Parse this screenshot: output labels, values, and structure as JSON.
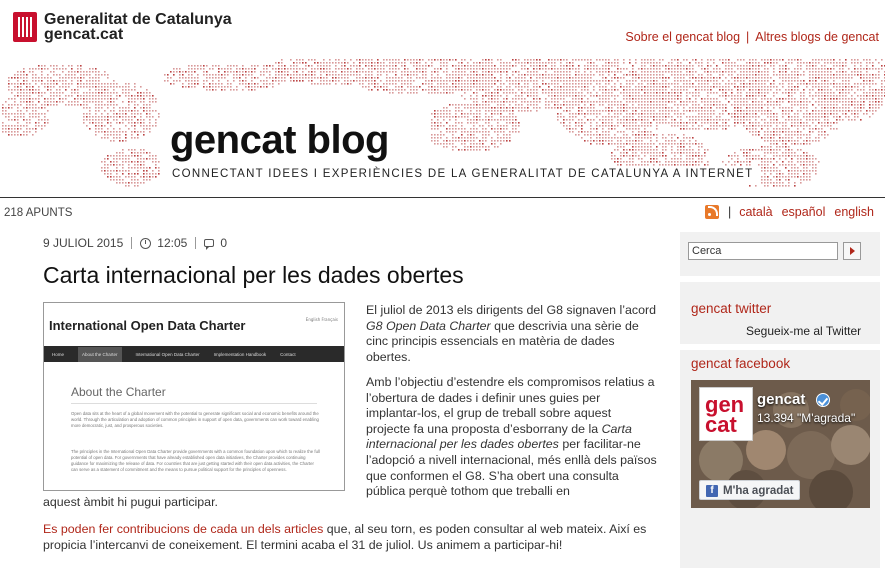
{
  "header": {
    "org_name": "Generalitat de Catalunya",
    "org_domain": "gencat.cat",
    "links": [
      "Sobre el gencat blog",
      "Altres blogs de gencat"
    ],
    "separator": "|"
  },
  "banner": {
    "title": "gencat blog",
    "tagline": "CONNECTANT IDEES I EXPERIÈNCIES DE LA GENERALITAT DE CATALUNYA A INTERNET"
  },
  "subbar": {
    "post_count": "218 APUNTS",
    "rss_icon": "rss-icon",
    "separator": "|",
    "languages": [
      "català",
      "español",
      "english"
    ]
  },
  "post": {
    "date": "9 JULIOL 2015",
    "time": "12:05",
    "comments": "0",
    "title": "Carta internacional per les dades obertes",
    "image": {
      "title": "International Open Data Charter",
      "langs": "English  Français",
      "nav": [
        "Home",
        "About the Charter",
        "International Open Data Charter",
        "Implementation Handbook",
        "Contact"
      ],
      "heading": "About the Charter",
      "p1": "Open data sits at the heart of a global movement with the potential to generate significant social and economic benefits around the world. Through the articulation and adoption of common principles in support of open data, governments can work toward enabling more democratic, just, and prosperous societies.",
      "p2": "The principles in the International Open Data Charter provide governments with a common foundation upon which to realize the full potential of open data. For governments that have already established open data initiatives, the Charter provides continuing guidance for maximizing the release of data. For countries that are just getting started with their open data activities, the Charter can serve as a statement of commitment and the means to pursue political support for the principles of openness."
    },
    "para1_a": "El juliol de 2013 els dirigents del G8 signaven l’acord ",
    "para1_em": "G8 Open Data Charter",
    "para1_b": " que descrivia una sèrie de cinc principis essencials en matèria de dades obertes.",
    "para2_a": "Amb l’objectiu d’estendre els compromisos relatius a l’obertura de dades i definir unes guies per implantar-los, el grup de treball sobre aquest projecte fa una proposta d’esborrany de la ",
    "para2_em": "Carta internacional per les dades obertes",
    "para2_b": " per facilitar-ne l’adopció a nivell internacional, més enllà dels països que conformen el G8. S’ha obert una consulta pública perquè tothom que treballi en",
    "para2_c": "aquest àmbit hi pugui participar.",
    "para3_link": "Es poden fer contribucions de cada un dels articles",
    "para3_rest": " que, al seu torn, es poden consultar al web mateix. Així es propicia l’intercanvi de coneixement. El termini acaba el 31 de juliol. Us animem a participar-hi!"
  },
  "sidebar": {
    "search_value": "Cerca",
    "twitter_heading": "gencat twitter",
    "twitter_link": "Segueix-me al Twitter",
    "facebook_heading": "gencat facebook",
    "fb_page_name": "gencat",
    "fb_logo_line1": "gen",
    "fb_logo_line2": "cat",
    "fb_likes": "13.394 \"M'agrada\"",
    "fb_like_button": "M'ha agradat"
  }
}
